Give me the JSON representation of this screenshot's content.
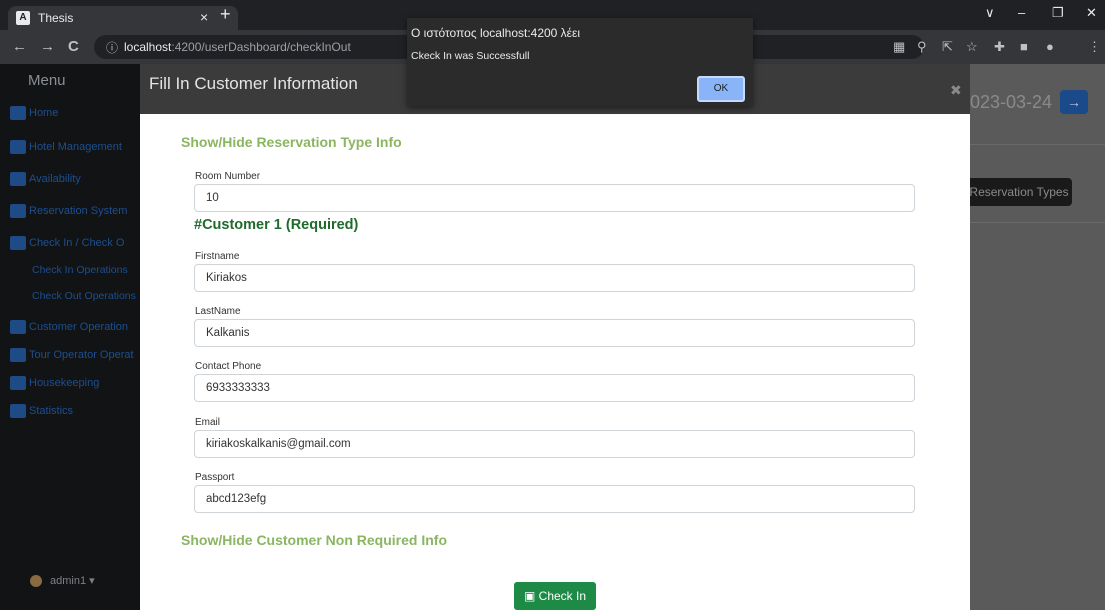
{
  "browser": {
    "tab_title": "Thesis",
    "tab_favicon": "A",
    "tab_close": "×",
    "new_tab": "+",
    "url_host": "localhost",
    "url_path": ":4200/userDashboard/checkInOut",
    "info_icon": "ⓘ",
    "icons": {
      "back": "←",
      "forward": "→",
      "reload": "C",
      "minimize": "–",
      "restore": "❐",
      "close": "✕",
      "chevron": "∨"
    }
  },
  "alert": {
    "title": "Ο ιστότοπος localhost:4200 λέει",
    "message": "Ckeck In was Successfull",
    "ok_label": "OK"
  },
  "sidebar": {
    "menu_title": "Menu",
    "items": [
      {
        "label": "Home"
      },
      {
        "label": "Hotel Management"
      },
      {
        "label": "Availability"
      },
      {
        "label": "Reservation System"
      },
      {
        "label": "Check In / Check O"
      },
      {
        "label": "Check In Operations"
      },
      {
        "label": "Check Out Operations"
      },
      {
        "label": "Customer Operation"
      },
      {
        "label": "Tour Operator Operat"
      },
      {
        "label": "Housekeeping"
      },
      {
        "label": "Statistics"
      }
    ],
    "user": "admin1"
  },
  "background": {
    "date": "023-03-24",
    "arrow": "→",
    "button": "Reservation Types"
  },
  "modal": {
    "title": "Fill In Customer Information",
    "close": "✖",
    "reservation_toggle": "Show/Hide Reservation Type Info",
    "room_label": "Room Number",
    "room_value": "10",
    "customer_heading": "#Customer 1 (Required)",
    "fields": [
      {
        "label": "Firstname",
        "value": "Kiriakos"
      },
      {
        "label": "LastName",
        "value": "Kalkanis"
      },
      {
        "label": "Contact Phone",
        "value": "6933333333"
      },
      {
        "label": "Email",
        "value": "kiriakoskalkanis@gmail.com"
      },
      {
        "label": "Passport",
        "value": "abcd123efg"
      }
    ],
    "nonrequired_toggle": "Show/Hide Customer Non Required Info",
    "checkin_label": "Check In"
  }
}
